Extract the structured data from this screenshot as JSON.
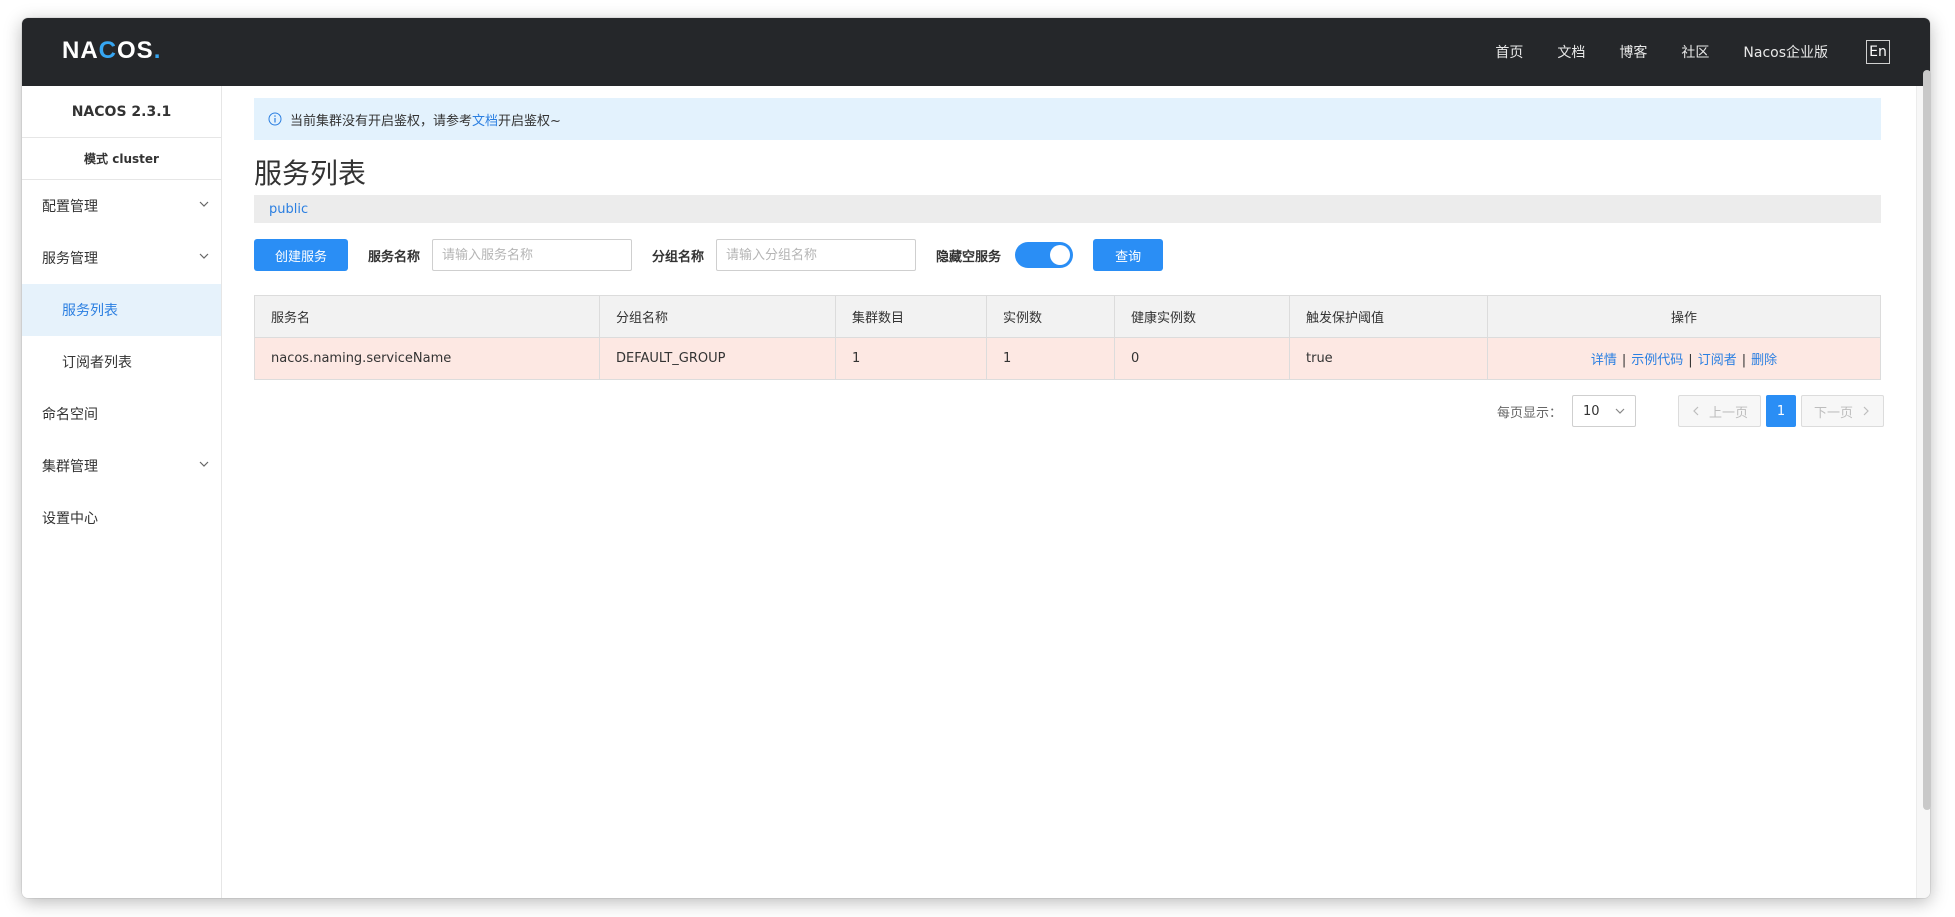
{
  "header": {
    "logo_left": "NA",
    "logo_c": "C",
    "logo_right": "OS",
    "logo_dot": ".",
    "nav": [
      "首页",
      "文档",
      "博客",
      "社区",
      "Nacos企业版"
    ],
    "lang": "En"
  },
  "sidebar": {
    "title": "NACOS 2.3.1",
    "mode": "模式 cluster",
    "items": [
      {
        "label": "配置管理",
        "expandable": true
      },
      {
        "label": "服务管理",
        "expandable": true
      },
      {
        "label": "服务列表",
        "sub": true,
        "active": true
      },
      {
        "label": "订阅者列表",
        "sub": true
      },
      {
        "label": "命名空间"
      },
      {
        "label": "集群管理",
        "expandable": true
      },
      {
        "label": "设置中心"
      }
    ]
  },
  "notice": {
    "text_before": "当前集群没有开启鉴权，请参考",
    "link": "文档",
    "text_after": "开启鉴权~"
  },
  "page": {
    "title": "服务列表",
    "namespace": "public"
  },
  "toolbar": {
    "create_label": "创建服务",
    "service_name_label": "服务名称",
    "service_name_placeholder": "请输入服务名称",
    "group_name_label": "分组名称",
    "group_name_placeholder": "请输入分组名称",
    "hide_empty_label": "隐藏空服务",
    "hide_empty_on": true,
    "query_label": "查询"
  },
  "table": {
    "columns": [
      "服务名",
      "分组名称",
      "集群数目",
      "实例数",
      "健康实例数",
      "触发保护阈值",
      "操作"
    ],
    "rows": [
      {
        "service": "nacos.naming.serviceName",
        "group": "DEFAULT_GROUP",
        "clusters": "1",
        "instances": "1",
        "healthy": "0",
        "threshold": "true",
        "ops": [
          "详情",
          "示例代码",
          "订阅者",
          "删除"
        ]
      }
    ]
  },
  "pagination": {
    "size_label": "每页显示：",
    "page_size": "10",
    "prev": "上一页",
    "current": "1",
    "next": "下一页"
  },
  "colors": {
    "primary": "#2a8ef5",
    "header_bg": "#25272a",
    "row_highlight": "#fde8e3",
    "notice_bg": "#e3f2fd"
  }
}
